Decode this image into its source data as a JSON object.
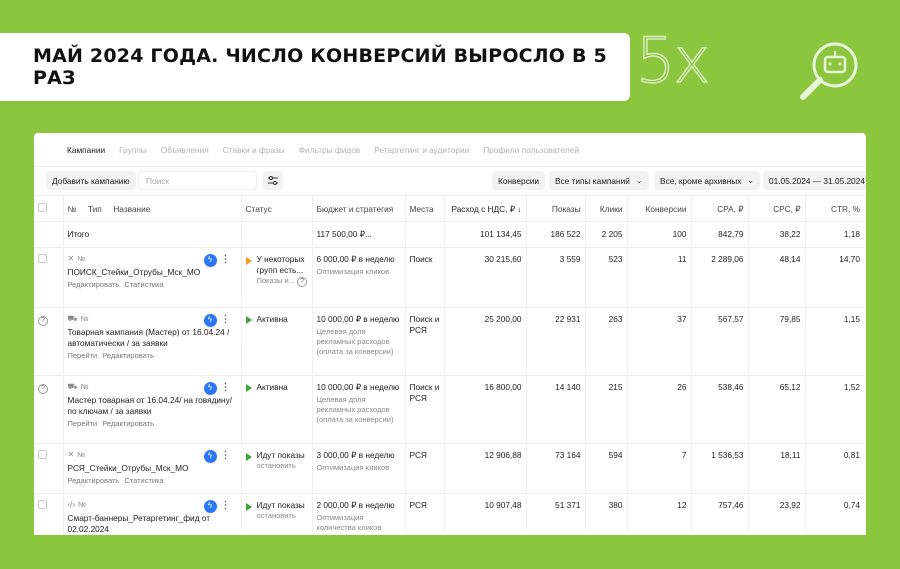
{
  "banner": {
    "title": "МАЙ 2024 ГОДА. ЧИСЛО КОНВЕРСИЙ ВЫРОСЛО В 5 РАЗ"
  },
  "badge": {
    "text": "5x"
  },
  "tabs": [
    "Кампании",
    "Группы",
    "Объявления",
    "Ставки и фразы",
    "Фильтры фидов",
    "Ретаргетинг и аудитории",
    "Профили пользователей"
  ],
  "toolbar": {
    "add_campaign": "Добавить кампанию",
    "search_placeholder": "Поиск",
    "conversions": "Конверсии",
    "campaign_types": "Все типы кампаний",
    "archive_filter": "Все, кроме архивных",
    "date_range": "01.05.2024 — 31.05.2024"
  },
  "table": {
    "headers": {
      "num": "№",
      "type": "Тип",
      "name": "Название",
      "status": "Статус",
      "budget": "Бюджет и стратегия",
      "places": "Места",
      "spend": "Расход с НДС, ₽ ↓",
      "impressions": "Показы",
      "clicks": "Клики",
      "conversions": "Конверсии",
      "cpa": "CPA, ₽",
      "cpc": "CPC, ₽",
      "ctr": "CTR, %"
    },
    "total": {
      "label": "Итого",
      "budget": "117 500,00 ₽...",
      "spend": "101 134,45",
      "impressions": "186 522",
      "clicks": "2 205",
      "conversions": "100",
      "cpa": "842,79",
      "cpc": "38,22",
      "ctr": "1,18"
    },
    "rows": [
      {
        "num": "№",
        "name": "ПОИСК_Стейки_Отрубы_Мск_МО",
        "link1": "Редактировать",
        "link2": "Статистика",
        "status": "У некоторых групп есть...",
        "status_sub": "Показы и...",
        "budget": "6 000,00 ₽ в неделю",
        "strategy": "Оптимизация кликов",
        "places": "Поиск",
        "spend": "30 215,60",
        "impressions": "3 559",
        "clicks": "523",
        "conversions": "11",
        "cpa": "2 289,06",
        "cpc": "48,14",
        "ctr": "14,70"
      },
      {
        "num": "№",
        "name": "Товарная кампания (Мастер) от 16.04.24 / автоматически / за заявки",
        "link1": "Перейти",
        "link2": "Редактировать",
        "status": "Активна",
        "status_sub": "",
        "budget": "10 000,00 ₽ в неделю",
        "strategy": "Целевая доля рекламных расходов (оплата за конверсии)",
        "places": "Поиск и РСЯ",
        "spend": "25 200,00",
        "impressions": "22 931",
        "clicks": "263",
        "conversions": "37",
        "cpa": "567,57",
        "cpc": "79,85",
        "ctr": "1,15"
      },
      {
        "num": "№",
        "name": "Мастер товарная от 16.04.24/ на говядину/ по ключам / за заявки",
        "link1": "Перейти",
        "link2": "Редактировать",
        "status": "Активна",
        "status_sub": "",
        "budget": "10 000,00 ₽ в неделю",
        "strategy": "Целевая доля рекламных расходов (оплата за конверсии)",
        "places": "Поиск и РСЯ",
        "spend": "16 800,00",
        "impressions": "14 140",
        "clicks": "215",
        "conversions": "26",
        "cpa": "538,46",
        "cpc": "65,12",
        "ctr": "1,52"
      },
      {
        "num": "№",
        "name": "РСЯ_Стейки_Отрубы_Мск_МО",
        "link1": "Редактировать",
        "link2": "Статистика",
        "status": "Идут показы",
        "status_sub": "остановить",
        "budget": "3 000,00 ₽ в неделю",
        "strategy": "Оптимизация кликов",
        "places": "РСЯ",
        "spend": "12 906,88",
        "impressions": "73 164",
        "clicks": "594",
        "conversions": "7",
        "cpa": "1 536,53",
        "cpc": "18,11",
        "ctr": "0,81"
      },
      {
        "num": "№",
        "name": "Смарт-баннеры_Ретаргетинг_фид от 02.02.2024",
        "link1": "Редактировать",
        "link2": "Статистика",
        "status": "Идут показы",
        "status_sub": "остановить",
        "budget": "2 000,00 ₽ в неделю",
        "strategy": "Оптимизация количества кликов",
        "places": "РСЯ",
        "spend": "10 907,48",
        "impressions": "51 371",
        "clicks": "380",
        "conversions": "12",
        "cpa": "757,46",
        "cpc": "23,92",
        "ctr": "0,74"
      }
    ]
  }
}
